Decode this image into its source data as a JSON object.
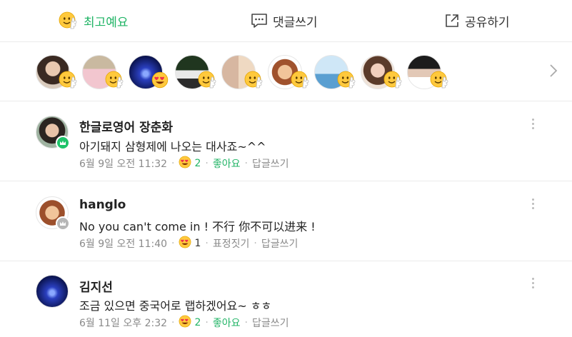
{
  "actions": {
    "best_label": "최고예요",
    "comment_label": "댓글쓰기",
    "share_label": "공유하기"
  },
  "reactors": {
    "count_visible": 9,
    "reaction_icon": "thumbs-up-emoji-icon",
    "more_icon": "chevron-right-icon"
  },
  "comments": [
    {
      "author": "한글로영어 장춘화",
      "text": "아기돼지 삼형제에 나오는 대사죠~^^",
      "date": "6월 9일 오전 11:32",
      "reaction_count": "2",
      "reaction_label": "좋아요",
      "reply_label": "답글쓰기",
      "badge": "green"
    },
    {
      "author": "hanglo",
      "text": "No you can't come in ! 不行 你不可以进来 !",
      "date": "6월 9일 오전 11:40",
      "reaction_count": "1",
      "reaction_label": "표정짓기",
      "reply_label": "답글쓰기",
      "badge": "gray"
    },
    {
      "author": "김지선",
      "text": "조금 있으면 중국어로 랩하겠어요~ ㅎㅎ",
      "date": "6월 11일 오후 2:32",
      "reaction_count": "2",
      "reaction_label": "좋아요",
      "reply_label": "답글쓰기",
      "badge": "none"
    }
  ],
  "colors": {
    "accent_green": "#21b466",
    "emoji_yellow": "#ffc93d",
    "meta_gray": "#8a8a8a",
    "divider": "#ebebeb"
  }
}
